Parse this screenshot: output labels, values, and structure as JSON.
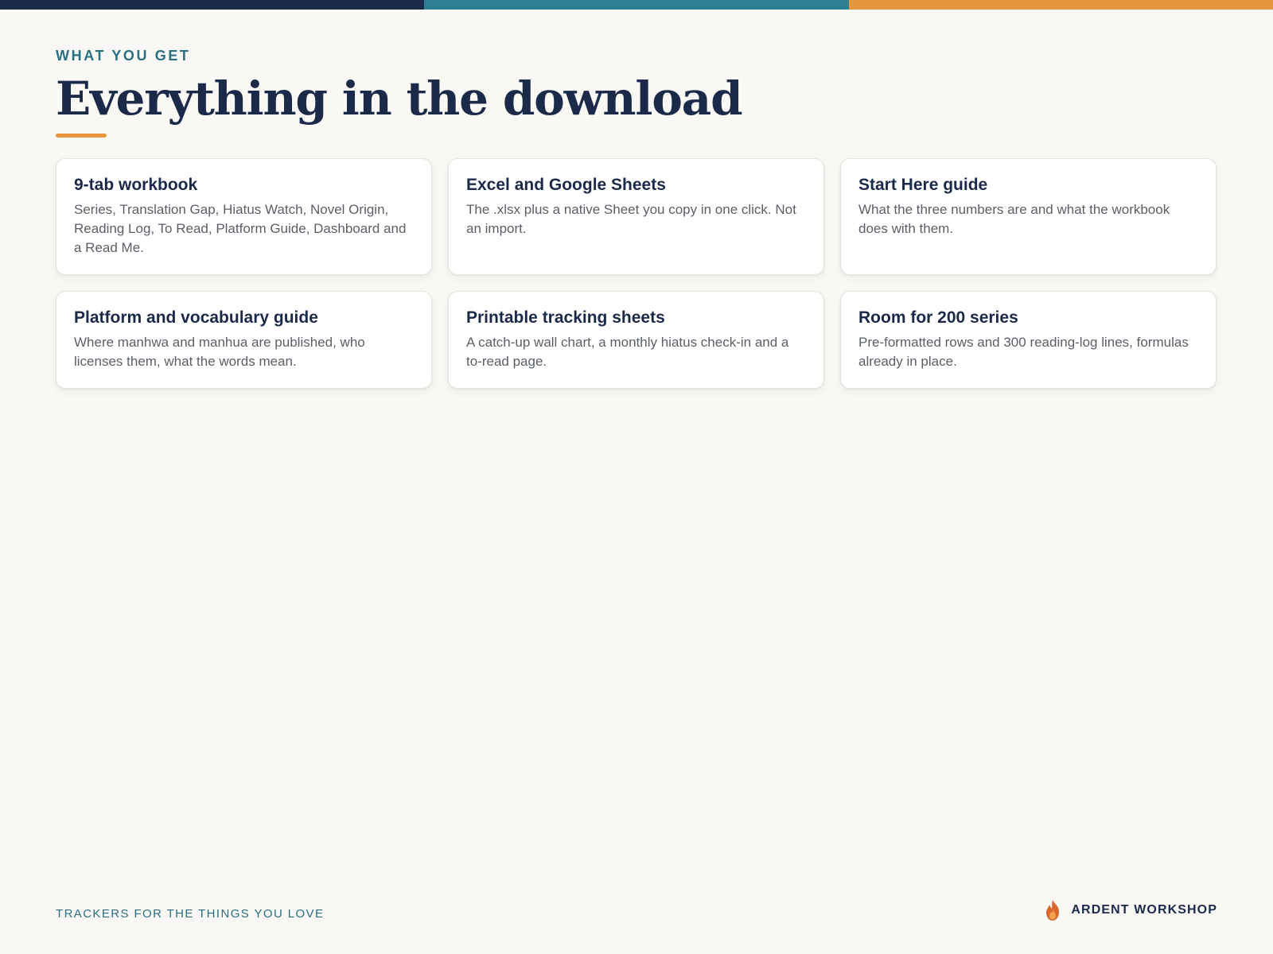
{
  "colors": {
    "navy": "#1c2a4a",
    "teal": "#2e7f91",
    "orange": "#e8963e",
    "background": "#f9f8f4"
  },
  "header": {
    "eyebrow": "WHAT YOU GET",
    "title": "Everything in the download"
  },
  "cards": [
    {
      "title": "9-tab workbook",
      "body": "Series, Translation Gap, Hiatus Watch, Novel Origin, Reading Log, To Read, Platform Guide, Dashboard and a Read Me."
    },
    {
      "title": "Excel and Google Sheets",
      "body": "The .xlsx plus a native Sheet you copy in one click. Not an import."
    },
    {
      "title": "Start Here guide",
      "body": "What the three numbers are and what the workbook does with them."
    },
    {
      "title": "Platform and vocabulary guide",
      "body": "Where manhwa and manhua are published, who licenses them, what the words mean."
    },
    {
      "title": "Printable tracking sheets",
      "body": "A catch-up wall chart, a monthly hiatus check-in and a to-read page."
    },
    {
      "title": "Room for 200 series",
      "body": "Pre-formatted rows and 300 reading-log lines, formulas already in place."
    }
  ],
  "footer": {
    "tagline": "TRACKERS FOR THE THINGS YOU LOVE",
    "brand": "ARDENT WORKSHOP",
    "brand_icon": "flame-icon"
  }
}
